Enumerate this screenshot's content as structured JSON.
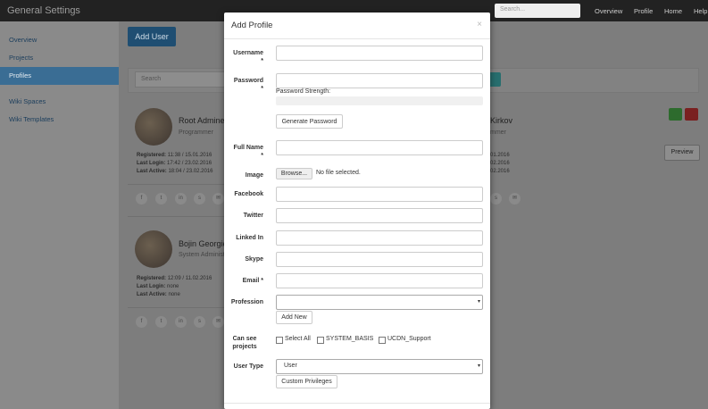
{
  "navbar": {
    "brand": "General Settings",
    "search_placeholder": "Search...",
    "links": [
      "Overview",
      "Profile",
      "Home",
      "Help"
    ]
  },
  "sidebar": {
    "items": [
      {
        "label": "Overview"
      },
      {
        "label": "Projects"
      },
      {
        "label": "Profiles",
        "active": true
      },
      {
        "label": "Wiki Spaces"
      },
      {
        "label": "Wiki Templates"
      }
    ]
  },
  "main": {
    "add_user_label": "Add User",
    "search_placeholder": "Search",
    "preview_label": "Preview",
    "users": [
      {
        "name": "Root Admine",
        "role": "Programmer",
        "registered_label": "Registered:",
        "registered": "11:38 / 15.01.2016",
        "last_login_label": "Last Login:",
        "last_login": "17:42 / 23.02.2016",
        "last_active_label": "Last Active:",
        "last_active": "18:04 / 23.02.2016"
      },
      {
        "name": "Bojin Georgie",
        "role": "System Administ",
        "registered_label": "Registered:",
        "registered": "12:09 / 11.02.2016",
        "last_login_label": "Last Login:",
        "last_login": "none",
        "last_active_label": "Last Active:",
        "last_active": "none"
      }
    ],
    "right_user": {
      "name": "Kirkov",
      "role": "mmer",
      "dates": [
        "01.2016",
        "02.2016",
        "02.2016"
      ]
    },
    "social_icons": [
      "facebook-icon",
      "twitter-icon",
      "linkedin-icon",
      "skype-icon",
      "mail-icon"
    ]
  },
  "modal": {
    "title": "Add Profile",
    "close": "×",
    "fields": {
      "username": "Username",
      "password": "Password",
      "password_strength": "Password Strength:",
      "generate_password": "Generate Password",
      "full_name": "Full Name",
      "image": "Image",
      "browse": "Browse...",
      "no_file": "No file selected.",
      "facebook": "Facebook",
      "twitter": "Twitter",
      "linked_in": "Linked In",
      "skype": "Skype",
      "email": "Email *",
      "profession": "Profession",
      "add_new": "Add New",
      "can_see_projects": "Can see projects",
      "select_all": "Select All",
      "system_basis": "SYSTEM_BASIS",
      "ucdn_support": "UCDN_Support",
      "user_type": "User Type",
      "user_type_value": "User",
      "custom_privileges": "Custom Privileges",
      "required_marker": "*"
    }
  }
}
